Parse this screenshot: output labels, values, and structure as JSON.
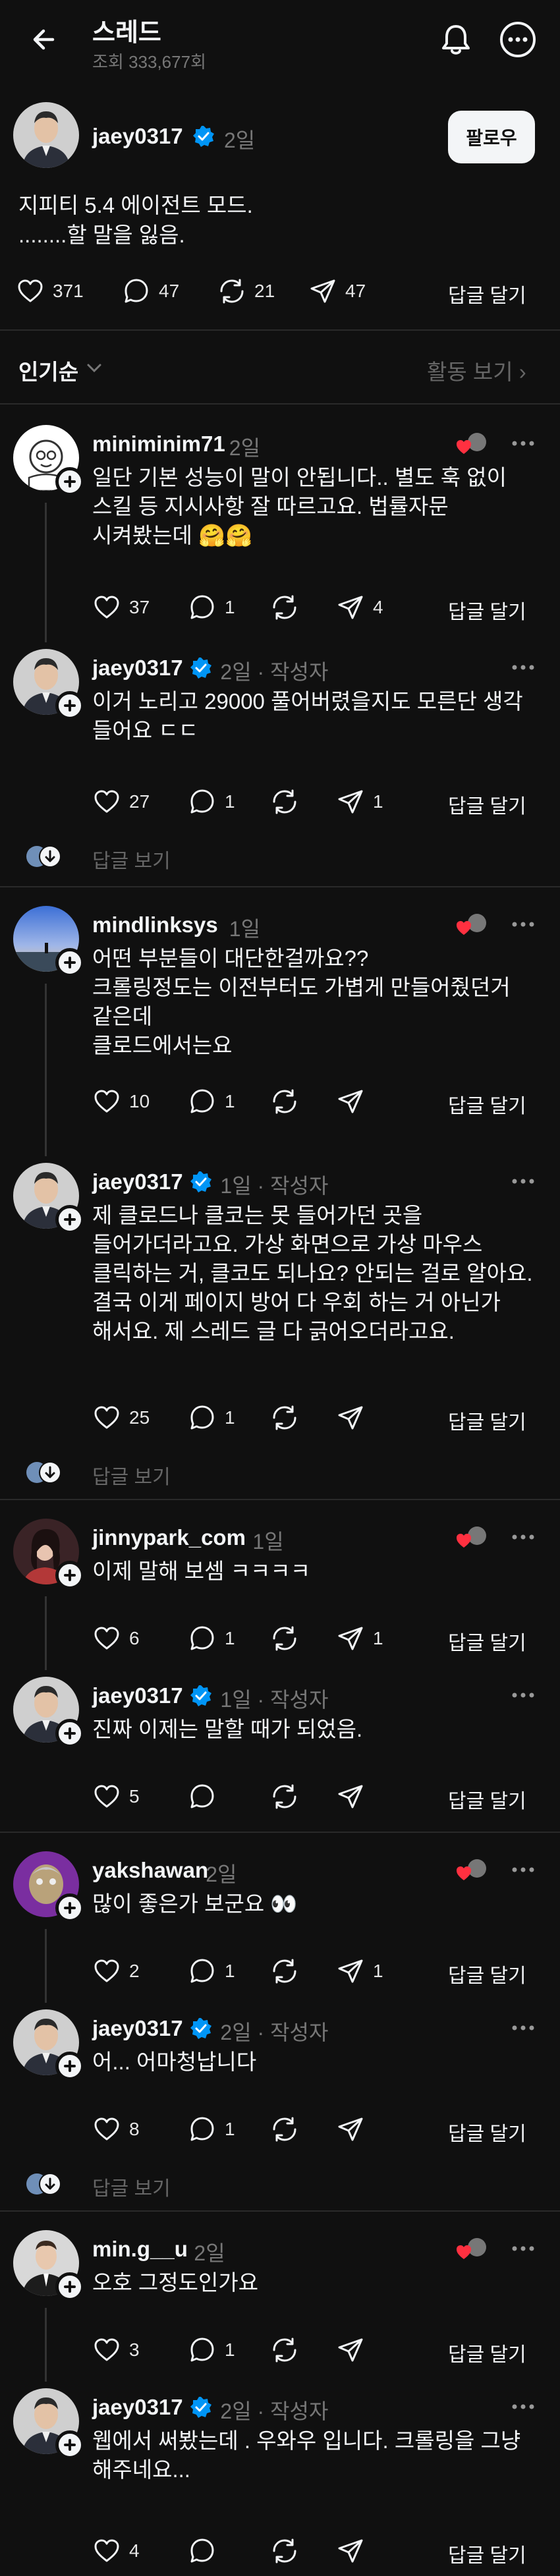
{
  "header": {
    "title": "스레드",
    "views": "조회 333,677회"
  },
  "main_post": {
    "username": "jaey0317",
    "time": "2일",
    "follow": "팔로우",
    "lines": [
      "지피티 5.4 에이전트 모드.",
      "........할 말을 잃음."
    ],
    "likes": "371",
    "comments": "47",
    "reposts": "21",
    "shares": "47",
    "reply": "답글 달기"
  },
  "sort": {
    "label": "인기순",
    "activity": "활동 보기"
  },
  "comments": [
    {
      "user": "miniminim71",
      "time": "2일",
      "lines": [
        "일단 기본 성능이 말이 안됩니다.. 별도 훅 없이",
        "스킬 등 지시사항 잘 따르고요. 법률자문",
        "시켜봤는데 🤗🤗"
      ],
      "likes": "37",
      "comments": "1",
      "shares": "4",
      "reply": "답글 달기"
    },
    {
      "user": "jaey0317",
      "time": "2일 · 작성자",
      "lines": [
        "이거 노리고 29000 풀어버렸을지도 모른단 생각",
        "들어요 ㄷㄷ"
      ],
      "likes": "27",
      "comments": "1",
      "shares": "1",
      "reply": "답글 달기"
    },
    {
      "user": "mindlinksys",
      "time": "1일",
      "lines": [
        "어떤 부분들이 대단한걸까요??",
        "크롤링정도는 이전부터도 가볍게 만들어줬던거",
        "같은데",
        "클로드에서는요"
      ],
      "likes": "10",
      "comments": "1",
      "shares": "",
      "reply": "답글 달기"
    },
    {
      "user": "jaey0317",
      "time": "1일 · 작성자",
      "lines": [
        "제 클로드나 클코는 못 들어가던 곳을",
        "들어가더라고요. 가상 화면으로 가상 마우스",
        "클릭하는 거, 클코도 되나요? 안되는 걸로 알아요.",
        "결국 이게 페이지 방어 다 우회 하는 거 아닌가",
        "해서요. 제 스레드 글 다 긁어오더라고요."
      ],
      "likes": "25",
      "comments": "1",
      "shares": "",
      "reply": "답글 달기"
    },
    {
      "user": "jinnypark_com",
      "time": "1일",
      "lines": [
        "이제 말해 보셈 ㅋㅋㅋㅋ"
      ],
      "likes": "6",
      "comments": "1",
      "shares": "1",
      "reply": "답글 달기"
    },
    {
      "user": "jaey0317",
      "time": "1일 · 작성자",
      "lines": [
        "진짜 이제는 말할 때가 되었음."
      ],
      "likes": "5",
      "comments": "",
      "shares": "",
      "reply": "답글 달기"
    },
    {
      "user": "yakshawan",
      "time": "2일",
      "lines": [
        "많이 좋은가 보군요 👀"
      ],
      "likes": "2",
      "comments": "1",
      "shares": "1",
      "reply": "답글 달기"
    },
    {
      "user": "jaey0317",
      "time": "2일 · 작성자",
      "lines": [
        "어... 어마청납니다"
      ],
      "likes": "8",
      "comments": "1",
      "shares": "",
      "reply": "답글 달기"
    },
    {
      "user": "min.g__u",
      "time": "2일",
      "lines": [
        "오호 그정도인가요"
      ],
      "likes": "3",
      "comments": "1",
      "shares": "",
      "reply": "답글 달기"
    },
    {
      "user": "jaey0317",
      "time": "2일 · 작성자",
      "lines": [
        "웹에서 써봤는데 . 우와우 입니다. 크롤링을 그냥",
        "해주네요..."
      ],
      "likes": "4",
      "comments": "",
      "shares": "",
      "reply": "답글 달기"
    }
  ],
  "see_replies": "답글 보기",
  "colors": {
    "background": "#101010",
    "text": "#f3f5f7",
    "muted": "#777777",
    "verified": "#0095f6",
    "heart_red": "#ff3040"
  }
}
